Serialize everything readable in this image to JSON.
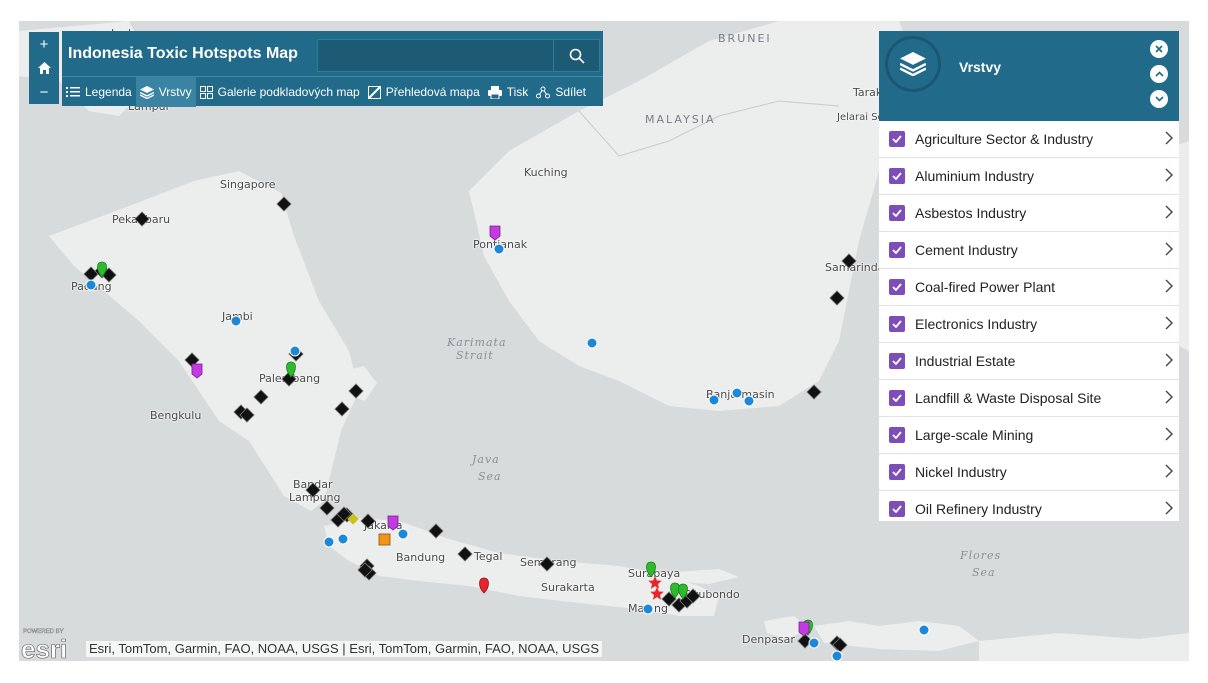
{
  "app": {
    "title": "Indonesia Toxic Hotspots Map"
  },
  "search": {
    "placeholder": ""
  },
  "zoom": {
    "in": "+",
    "home": "home-icon",
    "out": "−"
  },
  "toolbar": [
    {
      "icon": "list-icon",
      "label": "Legenda",
      "active": false
    },
    {
      "icon": "layers-icon",
      "label": "Vrstvy",
      "active": true
    },
    {
      "icon": "basemap-gallery-icon",
      "label": "Galerie podkladových map",
      "active": false
    },
    {
      "icon": "overview-map-icon",
      "label": "Přehledová mapa",
      "active": false
    },
    {
      "icon": "print-icon",
      "label": "Tisk",
      "active": false
    },
    {
      "icon": "share-icon",
      "label": "Sdílet",
      "active": false
    }
  ],
  "layers_panel": {
    "title": "Vrstvy",
    "items": [
      {
        "label": "Agriculture Sector & Industry",
        "checked": true
      },
      {
        "label": "Aluminium Industry",
        "checked": true
      },
      {
        "label": "Asbestos Industry",
        "checked": true
      },
      {
        "label": "Cement Industry",
        "checked": true
      },
      {
        "label": "Coal-fired Power Plant",
        "checked": true
      },
      {
        "label": "Electronics Industry",
        "checked": true
      },
      {
        "label": "Industrial Estate",
        "checked": true
      },
      {
        "label": "Landfill & Waste Disposal Site",
        "checked": true
      },
      {
        "label": "Large-scale Mining",
        "checked": true
      },
      {
        "label": "Nickel Industry",
        "checked": true
      },
      {
        "label": "Oil Refinery Industry",
        "checked": true
      }
    ]
  },
  "map": {
    "places": [
      "Ipoh",
      "Lumpur",
      "Singapore",
      "Pekanbaru",
      "Padang",
      "Jambi",
      "Palembang",
      "Bengkulu",
      "Bandar",
      "Lampung",
      "Jakarta",
      "Bandung",
      "Tegal",
      "Semarang",
      "Surakarta",
      "Surabaya",
      "Malang",
      "Situbondo",
      "Denpasar",
      "Pontianak",
      "Kuching",
      "Banjarmasin",
      "Samarinda",
      "Tarak",
      "Jelarai Se"
    ],
    "regions": [
      "BRUNEI",
      "MALAYSIA"
    ],
    "seas": [
      "Karimata",
      "Strait",
      "Java",
      "Sea",
      "Flores",
      "Sea"
    ],
    "colors": {
      "land": "#eceded",
      "water": "#d7dadb",
      "diamond": "#111111",
      "blue": "#1e88d8",
      "green": "#2dbb2d",
      "magenta": "#c33be0",
      "red": "#e8242c",
      "orange": "#f2941a",
      "yellow": "#c8c41e"
    }
  },
  "attribution": "Esri, TomTom, Garmin, FAO, NOAA, USGS | Esri, TomTom, Garmin, FAO, NOAA, USGS",
  "esri_logo": {
    "powered_by": "POWERED BY",
    "brand": "esri"
  }
}
